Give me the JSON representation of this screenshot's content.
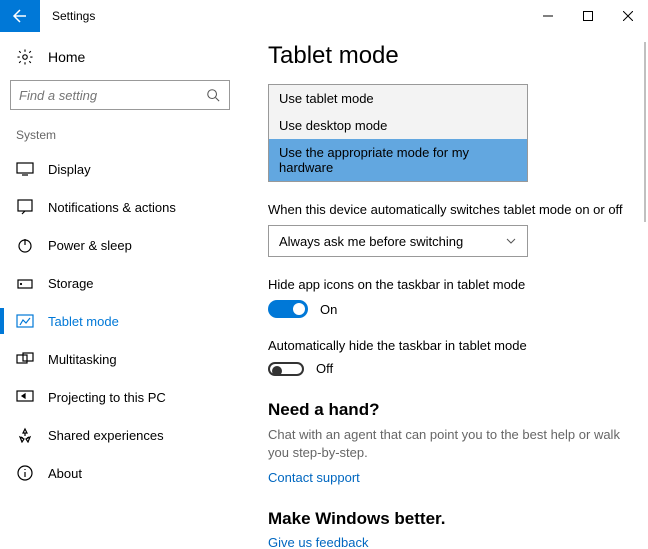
{
  "window": {
    "title": "Settings"
  },
  "sidebar": {
    "home": "Home",
    "search_placeholder": "Find a setting",
    "group": "System",
    "items": [
      {
        "label": "Display"
      },
      {
        "label": "Notifications & actions"
      },
      {
        "label": "Power & sleep"
      },
      {
        "label": "Storage"
      },
      {
        "label": "Tablet mode"
      },
      {
        "label": "Multitasking"
      },
      {
        "label": "Projecting to this PC"
      },
      {
        "label": "Shared experiences"
      },
      {
        "label": "About"
      }
    ]
  },
  "page": {
    "title": "Tablet mode",
    "signin_dropdown": {
      "options": [
        "Use tablet mode",
        "Use desktop mode",
        "Use the appropriate mode for my hardware"
      ],
      "selected_index": 2
    },
    "auto_label": "When this device automatically switches tablet mode on or off",
    "auto_value": "Always ask me before switching",
    "hide_icons_label": "Hide app icons on the taskbar in tablet mode",
    "hide_icons_state": "On",
    "auto_hide_label": "Automatically hide the taskbar in tablet mode",
    "auto_hide_state": "Off",
    "help_head": "Need a hand?",
    "help_text": "Chat with an agent that can point you to the best help or walk you step-by-step.",
    "help_link": "Contact support",
    "feedback_head": "Make Windows better.",
    "feedback_link": "Give us feedback"
  }
}
